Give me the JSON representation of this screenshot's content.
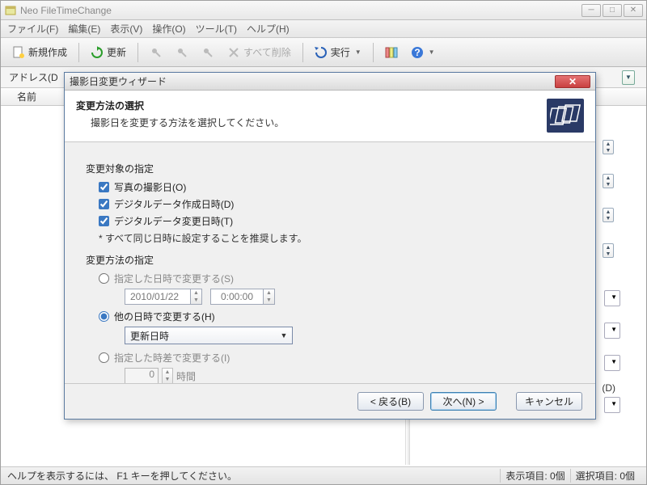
{
  "window": {
    "title": "Neo FileTimeChange"
  },
  "menu": {
    "file": "ファイル(F)",
    "edit": "編集(E)",
    "view": "表示(V)",
    "action": "操作(O)",
    "tools": "ツール(T)",
    "help": "ヘルプ(H)"
  },
  "toolbar": {
    "new": "新規作成",
    "refresh": "更新",
    "delete_all": "すべて削除",
    "run": "実行"
  },
  "address": {
    "label": "アドレス(D"
  },
  "listheader": {
    "name": "名前"
  },
  "right_sliver": {
    "d_label": "(D)"
  },
  "statusbar": {
    "help": "ヘルプを表示するには、 F1 キーを押してください。",
    "items": "表示項目: 0個",
    "selected": "選択項目: 0個"
  },
  "dialog": {
    "title": "撮影日変更ウィザード",
    "header_title": "変更方法の選択",
    "header_sub": "撮影日を変更する方法を選択してください。",
    "group_target": "変更対象の指定",
    "chk_shoot": "写真の撮影日(O)",
    "chk_dcreate": "デジタルデータ作成日時(D)",
    "chk_dmodify": "デジタルデータ変更日時(T)",
    "note": "* すべて同じ日時に設定することを推奨します。",
    "group_method": "変更方法の指定",
    "radio_specified": "指定した日時で変更する(S)",
    "date_value": "2010/01/22",
    "time_value": "0:00:00",
    "radio_other": "他の日時で変更する(H)",
    "combo_value": "更新日時",
    "radio_offset": "指定した時差で変更する(I)",
    "offset_value": "0",
    "offset_unit": "時間",
    "btn_back": "< 戻る(B)",
    "btn_next": "次へ(N) >",
    "btn_cancel": "キャンセル"
  }
}
